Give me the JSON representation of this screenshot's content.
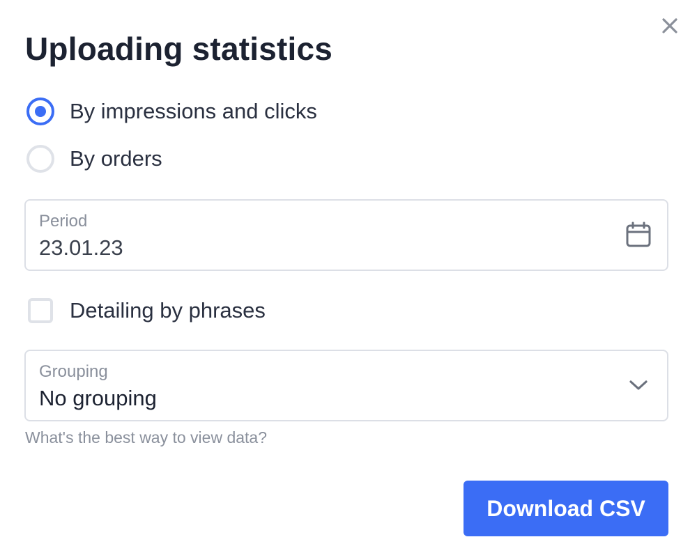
{
  "dialog": {
    "title": "Uploading statistics",
    "close_icon": "close-icon"
  },
  "stats_type": {
    "options": [
      {
        "label": "By impressions and clicks",
        "selected": true
      },
      {
        "label": "By orders",
        "selected": false
      }
    ]
  },
  "period": {
    "label": "Period",
    "value": "23.01.23",
    "icon": "calendar-icon"
  },
  "detailing": {
    "label": "Detailing by phrases",
    "checked": false
  },
  "grouping": {
    "label": "Grouping",
    "value": "No grouping",
    "icon": "chevron-down-icon",
    "hint": "What's the best way to view data?"
  },
  "actions": {
    "download_label": "Download CSV"
  },
  "colors": {
    "accent": "#3b6df5",
    "text_primary": "#1c2231",
    "text_secondary": "#8a909c",
    "border": "#dcdfe6"
  }
}
